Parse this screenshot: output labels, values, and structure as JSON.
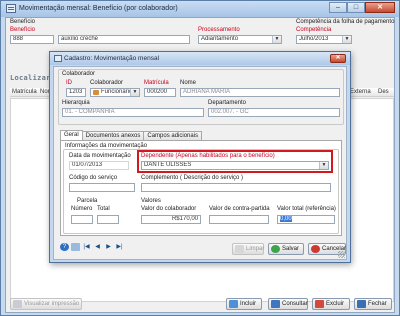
{
  "window": {
    "title": "Movimentação mensal: Benefício (por colaborador)",
    "min": "–",
    "max": "□",
    "close": "✕"
  },
  "filters": {
    "beneficio_label": "Benefício",
    "beneficio_sub": "Benefício",
    "beneficio_code": "888",
    "beneficio_name": "auxílio creche",
    "processamento_label": "Processamento",
    "processamento_value": "Adiantamento",
    "competencia_folha_label": "Competência da folha de pagamento",
    "competencia_label": "Competência",
    "competencia_value": "Julho/2013"
  },
  "list": {
    "localizar": "Localizar",
    "columns": [
      "Matrícula",
      "Nome",
      "Externa",
      "Des"
    ]
  },
  "bottom": {
    "visualizar": "Visualizar impressão",
    "incluir": "Incluir",
    "consultar": "Consultar",
    "excluir": "Excluir",
    "fechar": "Fechar"
  },
  "modal": {
    "title": "Cadastro: Movimentação mensal",
    "close": "✕",
    "colaborador_label": "Colaborador",
    "id_label": "ID",
    "id_value": "1203",
    "colaborador_field_label": "Colaborador",
    "colaborador_type": "Funcionário",
    "matricula_label": "Matrícula",
    "matricula_value": "000200",
    "nome_label": "Nome",
    "nome_value": "ADRIANA MARIA",
    "hierarquia_label": "Hierarquia",
    "hierarquia_value": "01.              - COMPANHIA",
    "departamento_label": "Departamento",
    "departamento_value": "002.007.          - GC",
    "tabs": [
      "Geral",
      "Documentos anexos",
      "Campos adicionais"
    ],
    "info_label": "Informações da movimentação",
    "data_mov_label": "Data da movimentação",
    "data_mov_value": "01/07/2013",
    "dependente_label": "Dependente (Apenas habilitados para o benefício)",
    "dependente_value": "DANTE ULISSES",
    "codigo_servico_label": "Código do serviço",
    "complemento_label": "Complemento ( Descrição do serviço )",
    "parcela_label": "Parcela",
    "numero_label": "Número",
    "total_label": "Total",
    "valores_label": "Valores",
    "valor_colab_label": "Valor do colaborador",
    "valor_colab_value": "R$170,00",
    "valor_contra_label": "Valor de contra-partida",
    "valor_total_label": "Valor total (referência)",
    "valor_total_value": "0,00",
    "limpar": "Limpar",
    "salvar": "Salvar",
    "cancelar": "Cancelar"
  },
  "colors": {
    "highlight": "#d2191e",
    "required_label": "#c8001e",
    "selection": "#3a7bd5"
  }
}
